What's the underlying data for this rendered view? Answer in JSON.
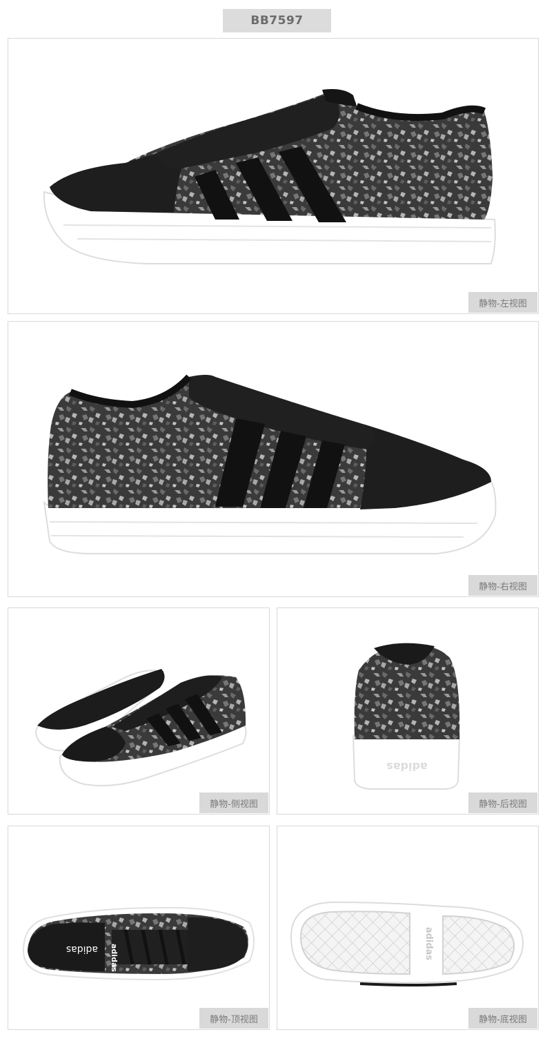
{
  "product": {
    "code": "BB7597"
  },
  "views": [
    {
      "id": "left",
      "caption": "静物-左视图"
    },
    {
      "id": "right",
      "caption": "静物-右视图"
    },
    {
      "id": "side",
      "caption": "静物-侧视图"
    },
    {
      "id": "back",
      "caption": "静物-后视图"
    },
    {
      "id": "top",
      "caption": "静物-顶视图"
    },
    {
      "id": "bottom",
      "caption": "静物-底视图"
    }
  ],
  "colors": {
    "upper": "#1c1c1c",
    "pattern_light": "#8e8e8e",
    "pattern_mid": "#555555",
    "sole": "#ffffff",
    "caption_bg": "#d9d9d9"
  }
}
